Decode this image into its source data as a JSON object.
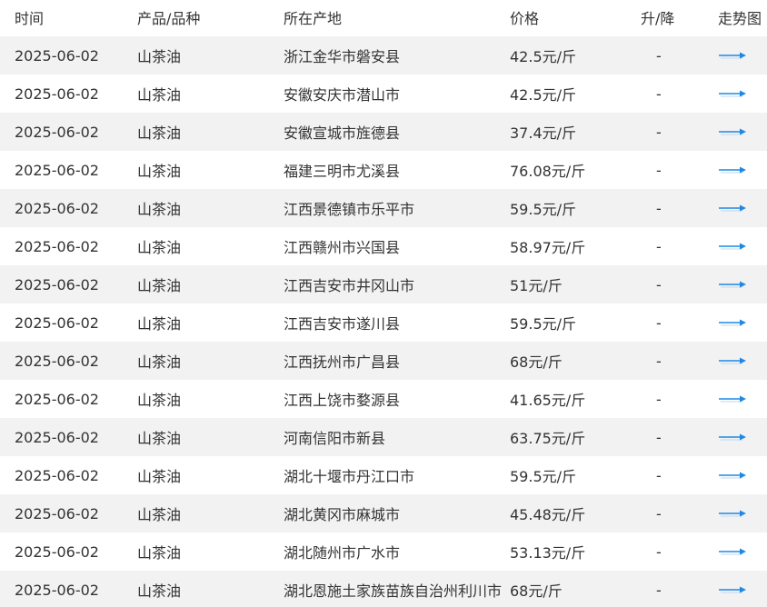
{
  "header": {
    "time": "时间",
    "product": "产品/品种",
    "location": "所在产地",
    "price": "价格",
    "change": "升/降",
    "trend": "走势图"
  },
  "accent_color": "#1e88e5",
  "trend_icon": "arrow-right-icon",
  "rows": [
    {
      "date": "2025-06-02",
      "product": "山茶油",
      "location": "浙江金华市磐安县",
      "price": "42.5元/斤",
      "change": "-"
    },
    {
      "date": "2025-06-02",
      "product": "山茶油",
      "location": "安徽安庆市潜山市",
      "price": "42.5元/斤",
      "change": "-"
    },
    {
      "date": "2025-06-02",
      "product": "山茶油",
      "location": "安徽宣城市旌德县",
      "price": "37.4元/斤",
      "change": "-"
    },
    {
      "date": "2025-06-02",
      "product": "山茶油",
      "location": "福建三明市尤溪县",
      "price": "76.08元/斤",
      "change": "-"
    },
    {
      "date": "2025-06-02",
      "product": "山茶油",
      "location": "江西景德镇市乐平市",
      "price": "59.5元/斤",
      "change": "-"
    },
    {
      "date": "2025-06-02",
      "product": "山茶油",
      "location": "江西赣州市兴国县",
      "price": "58.97元/斤",
      "change": "-"
    },
    {
      "date": "2025-06-02",
      "product": "山茶油",
      "location": "江西吉安市井冈山市",
      "price": "51元/斤",
      "change": "-"
    },
    {
      "date": "2025-06-02",
      "product": "山茶油",
      "location": "江西吉安市遂川县",
      "price": "59.5元/斤",
      "change": "-"
    },
    {
      "date": "2025-06-02",
      "product": "山茶油",
      "location": "江西抚州市广昌县",
      "price": "68元/斤",
      "change": "-"
    },
    {
      "date": "2025-06-02",
      "product": "山茶油",
      "location": "江西上饶市婺源县",
      "price": "41.65元/斤",
      "change": "-"
    },
    {
      "date": "2025-06-02",
      "product": "山茶油",
      "location": "河南信阳市新县",
      "price": "63.75元/斤",
      "change": "-"
    },
    {
      "date": "2025-06-02",
      "product": "山茶油",
      "location": "湖北十堰市丹江口市",
      "price": "59.5元/斤",
      "change": "-"
    },
    {
      "date": "2025-06-02",
      "product": "山茶油",
      "location": "湖北黄冈市麻城市",
      "price": "45.48元/斤",
      "change": "-"
    },
    {
      "date": "2025-06-02",
      "product": "山茶油",
      "location": "湖北随州市广水市",
      "price": "53.13元/斤",
      "change": "-"
    },
    {
      "date": "2025-06-02",
      "product": "山茶油",
      "location": "湖北恩施土家族苗族自治州利川市",
      "price": "68元/斤",
      "change": "-"
    }
  ]
}
